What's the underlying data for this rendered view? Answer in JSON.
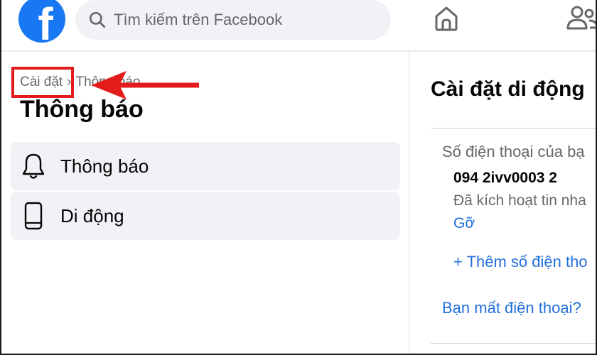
{
  "topbar": {
    "logo_letter": "f",
    "search_placeholder": "Tìm kiếm trên Facebook",
    "icons": [
      "facebook-logo",
      "search-icon",
      "home-icon",
      "friends-icon"
    ]
  },
  "left": {
    "breadcrumb": {
      "root": "Cài đặt",
      "separator": "›",
      "current": "Thông báo"
    },
    "title": "Thông báo",
    "menu": [
      {
        "label": "Thông báo",
        "icon": "bell-icon"
      },
      {
        "label": "Di động",
        "icon": "mobile-phone-icon"
      }
    ]
  },
  "right": {
    "title": "Cài đặt di động",
    "phone_section_label": "Số điện thoại của bạ",
    "phone_number": "094 2ivv0003 2",
    "status": "Đã kích hoạt tin nha",
    "remove_label": "Gỡ",
    "add_phone_label": "+ Thêm số điện tho",
    "lost_phone_label": "Bạn mất điện thoại?"
  },
  "colors": {
    "brand": "#1877f2",
    "link": "#216fdb",
    "annotation": "#e31b1b",
    "panel_bg": "#f0f2f5"
  }
}
